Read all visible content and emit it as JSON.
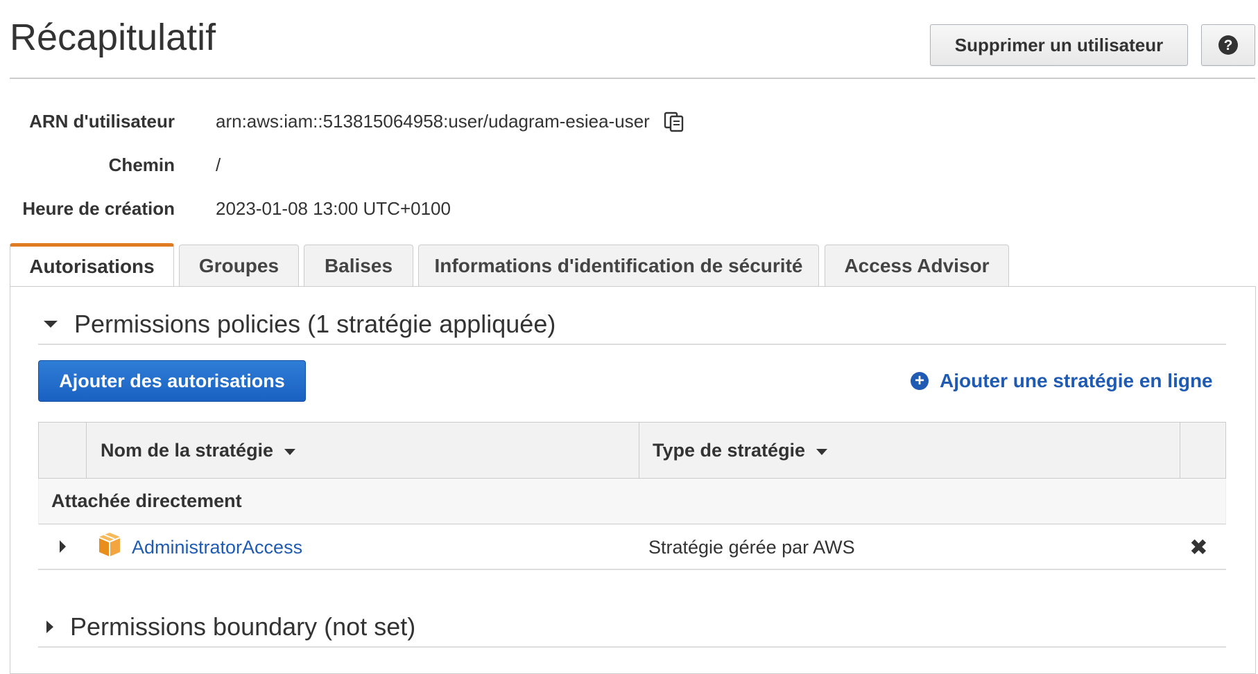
{
  "page": {
    "title": "Récapitulatif"
  },
  "header": {
    "delete_label": "Supprimer un utilisateur",
    "help_glyph": "?",
    "help_icon": "question-circle-icon"
  },
  "summary": {
    "arn_label": "ARN d'utilisateur",
    "arn_value": "arn:aws:iam::513815064958:user/udagram-esiea-user",
    "copy_icon": "copy-icon",
    "path_label": "Chemin",
    "path_value": "/",
    "created_label": "Heure de création",
    "created_value": "2023-01-08 13:00 UTC+0100"
  },
  "tabs": [
    {
      "label": "Autorisations",
      "active": true
    },
    {
      "label": "Groupes",
      "active": false
    },
    {
      "label": "Balises",
      "active": false
    },
    {
      "label": "Informations d'identification de sécurité",
      "active": false
    },
    {
      "label": "Access Advisor",
      "active": false
    }
  ],
  "permissions": {
    "section_title": "Permissions policies (1 stratégie appliquée)",
    "add_button": "Ajouter des autorisations",
    "inline_link": "Ajouter une stratégie en ligne",
    "plus_glyph": "+",
    "columns": {
      "name": "Nom de la stratégie",
      "type": "Type de stratégie"
    },
    "group_label": "Attachée directement",
    "policies": [
      {
        "name": "AdministratorAccess",
        "type": "Stratégie gérée par AWS",
        "icon": "aws-managed-policy-cube-icon",
        "remove_glyph": "✖"
      }
    ]
  },
  "boundary": {
    "section_title": "Permissions boundary (not set)"
  },
  "colors": {
    "accent_tab": "#e07b22",
    "primary_button": "#1a61c2",
    "link": "#1f5bb3",
    "policy_icon": "#f0a030"
  }
}
